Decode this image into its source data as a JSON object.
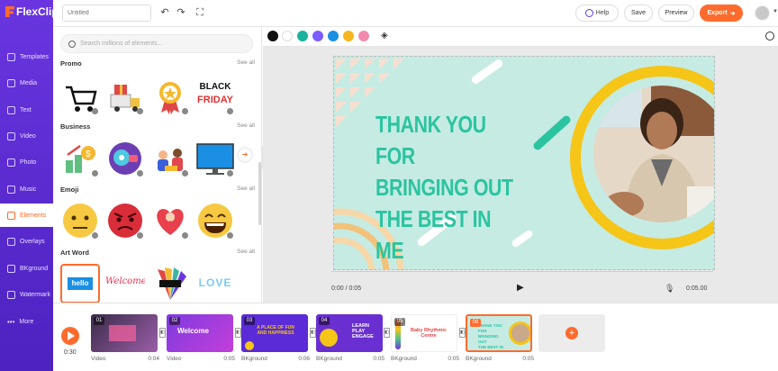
{
  "app": {
    "name": "FlexClip"
  },
  "topbar": {
    "title_placeholder": "Untitled",
    "help_label": "Help",
    "save_label": "Save",
    "preview_label": "Preview",
    "export_label": "Export"
  },
  "rail": {
    "items": [
      {
        "label": "Templates"
      },
      {
        "label": "Media"
      },
      {
        "label": "Text"
      },
      {
        "label": "Video"
      },
      {
        "label": "Photo"
      },
      {
        "label": "Music"
      },
      {
        "label": "Elements"
      },
      {
        "label": "Overlays"
      },
      {
        "label": "BKground"
      },
      {
        "label": "Watermark"
      },
      {
        "label": "More"
      }
    ],
    "active": "Elements"
  },
  "panel": {
    "search_placeholder": "Search millions of elements...",
    "categories": [
      {
        "name": "Promo",
        "see_all": "See all"
      },
      {
        "name": "Business",
        "see_all": "See all"
      },
      {
        "name": "Emoji",
        "see_all": "See all"
      },
      {
        "name": "Art Word",
        "see_all": "See all"
      }
    ],
    "promo_black_friday": [
      "BLACK",
      "FRIDAY"
    ],
    "artword": [
      "hello",
      "Welcome",
      "LOVE"
    ]
  },
  "colors": {
    "swatches": [
      "#111111",
      "#ffffff",
      "#19b39b",
      "#7b5cff",
      "#1a8fe3",
      "#f6b51e",
      "#f28ab0"
    ],
    "accent": "#ff6b2c",
    "brand": "#5a2bd6"
  },
  "canvas": {
    "headline": [
      "THANK YOU FOR",
      "BRINGING OUT",
      "THE BEST IN ME"
    ],
    "current_time": "0:00 / 0:05",
    "end_time": "0:05.00"
  },
  "timeline": {
    "total": "0:30",
    "clips": [
      {
        "num": "01",
        "label": "Video",
        "duration": "0:04"
      },
      {
        "num": "02",
        "label": "Video",
        "duration": "0:05"
      },
      {
        "num": "03",
        "label": "BKground",
        "duration": "0:06"
      },
      {
        "num": "04",
        "label": "BKground",
        "duration": "0:05"
      },
      {
        "num": "05",
        "label": "BKground",
        "duration": "0:05"
      },
      {
        "num": "06",
        "label": "BKground",
        "duration": "0:05"
      }
    ],
    "thumb_texts": {
      "t2": "Welcome",
      "t3": "A PLACE OF FUN AND HAPPINESS",
      "t4": "LEARN PLAY ENGAGE",
      "t5": "Baby Rhythmic Centre"
    }
  }
}
